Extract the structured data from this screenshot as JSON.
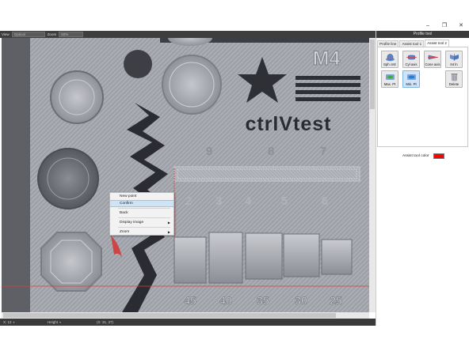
{
  "window": {
    "title": "Profile tool",
    "controls": [
      "–",
      "❐",
      "✕"
    ]
  },
  "view_toolbar": {
    "mode_label": "View",
    "mode_value": "Optical",
    "zoom_label": "Zoom",
    "zoom_value": "50%"
  },
  "status_bar": {
    "coord_value": "X: 12",
    "field_label": "Height",
    "position_value": "(X: 31, 37)"
  },
  "context_menu": {
    "items": [
      {
        "label": "New point"
      },
      {
        "label": "Confirm",
        "highlighted": true
      },
      {
        "label": "Back"
      },
      {
        "label": "Display image",
        "submenu": true
      },
      {
        "label": "Zoom",
        "submenu": true
      }
    ]
  },
  "panel": {
    "tabs": [
      {
        "label": "Profile line"
      },
      {
        "label": "Assist tool 1"
      },
      {
        "label": "Assist tool 2",
        "active": true
      }
    ],
    "tools": [
      {
        "label": "Sph cntr",
        "icon": "sphere-center-icon"
      },
      {
        "label": "Cyl axis",
        "icon": "cylinder-axis-icon"
      },
      {
        "label": "Cone axis",
        "icon": "cone-axis-icon"
      },
      {
        "label": "Int ln",
        "icon": "intersection-line-icon"
      },
      {
        "label": "Max. Pt",
        "icon": "max-point-icon"
      },
      {
        "label": "Min. Pt",
        "icon": "min-point-icon",
        "active": true
      },
      {
        "label": "Delete",
        "icon": "delete-icon"
      }
    ],
    "color_label": "Assist tool color",
    "assist_color": "#ff0000"
  },
  "image_text": {
    "logo_text": "ctrlVtest",
    "model_label": "M4",
    "digits_top": [
      "9",
      "8",
      "7"
    ],
    "digits_mid": [
      "2",
      "3",
      "4",
      "5",
      "6"
    ],
    "angle_labels": [
      "45",
      "40",
      "35",
      "30",
      "25"
    ]
  },
  "colors": {
    "accent": "#ff0000",
    "dark_bar": "#3b3b3b",
    "highlight": "#cfe3f7"
  }
}
